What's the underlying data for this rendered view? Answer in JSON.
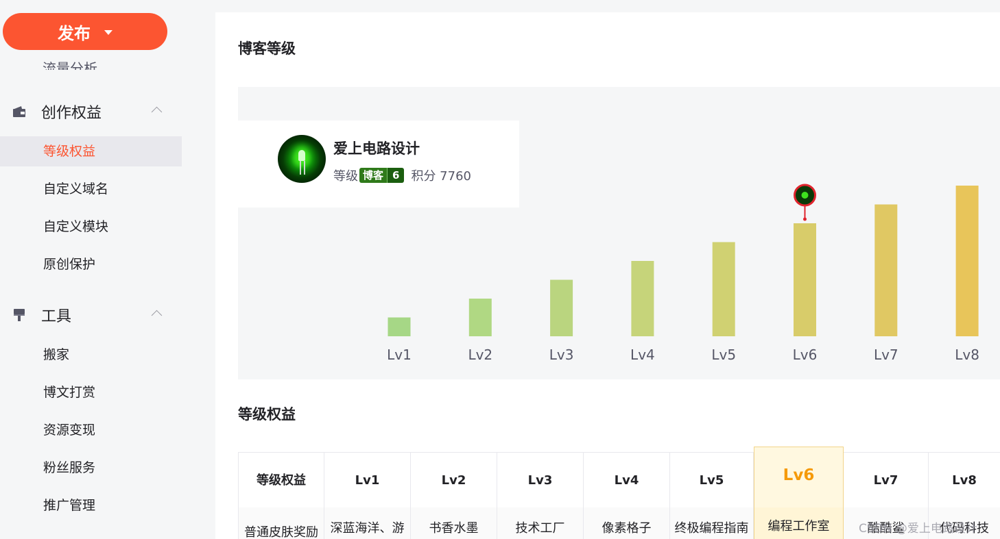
{
  "sidebar": {
    "publish_label": "发布",
    "cut_item_label": "流量分析",
    "groups": [
      {
        "title": "创作权益",
        "icon": "wallet-icon",
        "items": [
          "等级权益",
          "自定义域名",
          "自定义模块",
          "原创保护"
        ]
      },
      {
        "title": "工具",
        "icon": "brush-icon",
        "items": [
          "搬家",
          "博文打赏",
          "资源变现",
          "粉丝服务",
          "推广管理"
        ]
      }
    ],
    "active_item": "等级权益"
  },
  "main": {
    "blog_level_title": "博客等级",
    "rights_title": "等级权益",
    "profile": {
      "name": "爱上电路设计",
      "level_label": "等级",
      "badge_name": "博客",
      "badge_level": "6",
      "score_text": "积分 7760"
    }
  },
  "chart_data": {
    "type": "bar",
    "categories": [
      "Lv1",
      "Lv2",
      "Lv3",
      "Lv4",
      "Lv5",
      "Lv6",
      "Lv7",
      "Lv8"
    ],
    "values": [
      1,
      2,
      3,
      4,
      5,
      6,
      7,
      8
    ],
    "current": "Lv6",
    "colors": [
      "#a6d786",
      "#b0d883",
      "#bad57f",
      "#c6d47a",
      "#d0d172",
      "#d8cc6a",
      "#e0c863",
      "#e8c55a"
    ],
    "marker_icon": "avatar-pin-icon"
  },
  "table": {
    "headers": [
      "等级权益",
      "Lv1",
      "Lv2",
      "Lv3",
      "Lv4",
      "Lv5",
      "Lv6",
      "Lv7",
      "Lv8"
    ],
    "row": [
      "普通皮肤奖励",
      "深蓝海洋、游",
      "书香水墨",
      "技术工厂",
      "像素格子",
      "终极编程指南",
      "编程工作室",
      "酷酷鲨",
      "代码科技"
    ],
    "highlight": "Lv6"
  },
  "watermark": "CSDN @爱上电路设计",
  "colors": {
    "brand": "#fc5531",
    "highlight": "#f59a0a"
  }
}
